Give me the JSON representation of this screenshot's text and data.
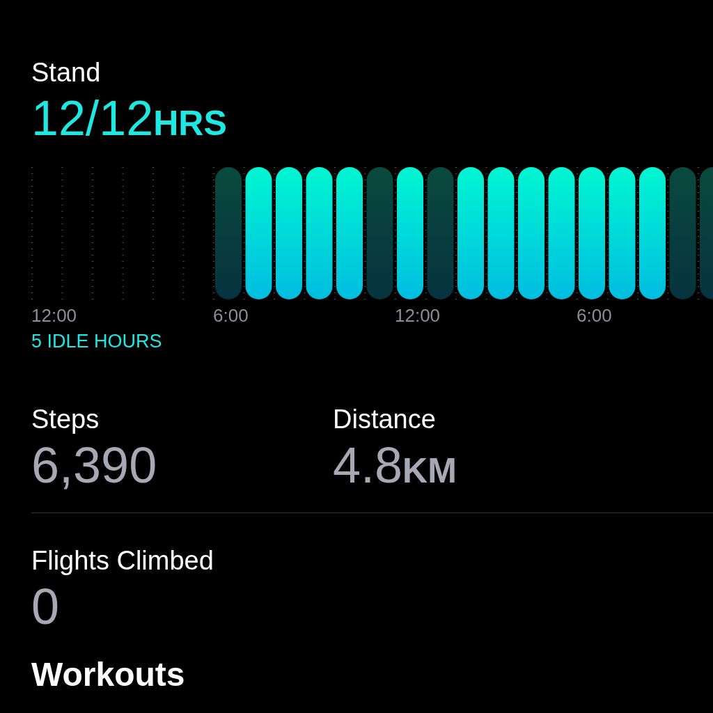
{
  "stand": {
    "label": "Stand",
    "value": "12/12",
    "unit": "HRS",
    "hours": [
      {
        "kind": "empty",
        "label": "12:00"
      },
      {
        "kind": "empty"
      },
      {
        "kind": "empty"
      },
      {
        "kind": "empty"
      },
      {
        "kind": "empty"
      },
      {
        "kind": "empty"
      },
      {
        "kind": "bar",
        "stood": false,
        "label": "6:00"
      },
      {
        "kind": "bar",
        "stood": true
      },
      {
        "kind": "bar",
        "stood": true
      },
      {
        "kind": "bar",
        "stood": true
      },
      {
        "kind": "bar",
        "stood": true
      },
      {
        "kind": "bar",
        "stood": false
      },
      {
        "kind": "bar",
        "stood": true,
        "label": "12:00"
      },
      {
        "kind": "bar",
        "stood": false
      },
      {
        "kind": "bar",
        "stood": true
      },
      {
        "kind": "bar",
        "stood": true
      },
      {
        "kind": "bar",
        "stood": true
      },
      {
        "kind": "bar",
        "stood": true
      },
      {
        "kind": "bar",
        "stood": true,
        "label": "6:00"
      },
      {
        "kind": "bar",
        "stood": true
      },
      {
        "kind": "bar",
        "stood": true
      },
      {
        "kind": "bar",
        "stood": false
      },
      {
        "kind": "bar",
        "stood": false
      }
    ],
    "idle_note": "5 IDLE HOURS"
  },
  "metrics": [
    {
      "label": "Steps",
      "value": "6,390"
    },
    {
      "label": "Distance",
      "value": "4.8",
      "unit": "KM"
    }
  ],
  "flights": {
    "label": "Flights Climbed",
    "value": "0"
  },
  "workouts": {
    "title": "Workouts"
  }
}
